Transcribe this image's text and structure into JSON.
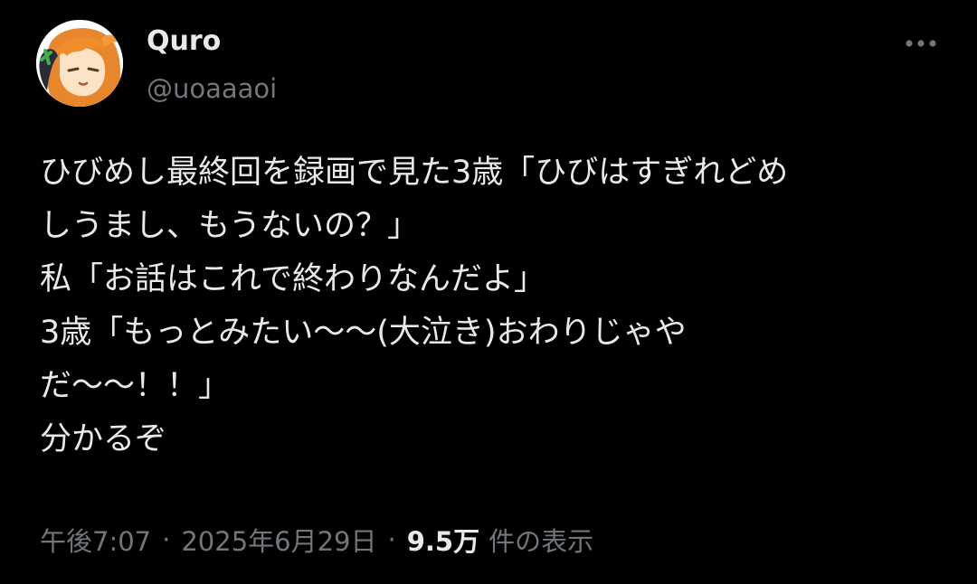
{
  "tweet": {
    "author": {
      "display_name": "Quro",
      "handle": "@uoaaaoi",
      "avatar_icon": "anime-girl-avatar-icon"
    },
    "more_icon": "more-options-icon",
    "text_lines": [
      "ひびめし最終回を録画で見た3歳「ひびはすぎれどめ",
      "しうまし、もうないの？」",
      "私「お話はこれで終わりなんだよ」",
      "3歳「もっとみたい〜〜(大泣き)おわりじゃや",
      "だ〜〜！！」",
      "分かるぞ"
    ],
    "meta": {
      "time": "午後7:07",
      "separator": "·",
      "date": "2025年6月29日",
      "views_count": "9.5万",
      "views_label": "件の表示"
    },
    "colors": {
      "background": "#000000",
      "primary_text": "#e7e9ea",
      "secondary_text": "#71767b"
    }
  }
}
